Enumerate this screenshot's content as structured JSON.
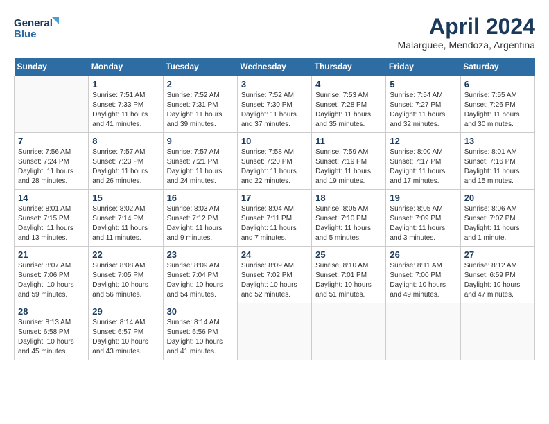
{
  "logo": {
    "line1": "General",
    "line2": "Blue"
  },
  "title": "April 2024",
  "subtitle": "Malarguee, Mendoza, Argentina",
  "days_of_week": [
    "Sunday",
    "Monday",
    "Tuesday",
    "Wednesday",
    "Thursday",
    "Friday",
    "Saturday"
  ],
  "weeks": [
    [
      {
        "day": "",
        "sunrise": "",
        "sunset": "",
        "daylight": ""
      },
      {
        "day": "1",
        "sunrise": "Sunrise: 7:51 AM",
        "sunset": "Sunset: 7:33 PM",
        "daylight": "Daylight: 11 hours and 41 minutes."
      },
      {
        "day": "2",
        "sunrise": "Sunrise: 7:52 AM",
        "sunset": "Sunset: 7:31 PM",
        "daylight": "Daylight: 11 hours and 39 minutes."
      },
      {
        "day": "3",
        "sunrise": "Sunrise: 7:52 AM",
        "sunset": "Sunset: 7:30 PM",
        "daylight": "Daylight: 11 hours and 37 minutes."
      },
      {
        "day": "4",
        "sunrise": "Sunrise: 7:53 AM",
        "sunset": "Sunset: 7:28 PM",
        "daylight": "Daylight: 11 hours and 35 minutes."
      },
      {
        "day": "5",
        "sunrise": "Sunrise: 7:54 AM",
        "sunset": "Sunset: 7:27 PM",
        "daylight": "Daylight: 11 hours and 32 minutes."
      },
      {
        "day": "6",
        "sunrise": "Sunrise: 7:55 AM",
        "sunset": "Sunset: 7:26 PM",
        "daylight": "Daylight: 11 hours and 30 minutes."
      }
    ],
    [
      {
        "day": "7",
        "sunrise": "Sunrise: 7:56 AM",
        "sunset": "Sunset: 7:24 PM",
        "daylight": "Daylight: 11 hours and 28 minutes."
      },
      {
        "day": "8",
        "sunrise": "Sunrise: 7:57 AM",
        "sunset": "Sunset: 7:23 PM",
        "daylight": "Daylight: 11 hours and 26 minutes."
      },
      {
        "day": "9",
        "sunrise": "Sunrise: 7:57 AM",
        "sunset": "Sunset: 7:21 PM",
        "daylight": "Daylight: 11 hours and 24 minutes."
      },
      {
        "day": "10",
        "sunrise": "Sunrise: 7:58 AM",
        "sunset": "Sunset: 7:20 PM",
        "daylight": "Daylight: 11 hours and 22 minutes."
      },
      {
        "day": "11",
        "sunrise": "Sunrise: 7:59 AM",
        "sunset": "Sunset: 7:19 PM",
        "daylight": "Daylight: 11 hours and 19 minutes."
      },
      {
        "day": "12",
        "sunrise": "Sunrise: 8:00 AM",
        "sunset": "Sunset: 7:17 PM",
        "daylight": "Daylight: 11 hours and 17 minutes."
      },
      {
        "day": "13",
        "sunrise": "Sunrise: 8:01 AM",
        "sunset": "Sunset: 7:16 PM",
        "daylight": "Daylight: 11 hours and 15 minutes."
      }
    ],
    [
      {
        "day": "14",
        "sunrise": "Sunrise: 8:01 AM",
        "sunset": "Sunset: 7:15 PM",
        "daylight": "Daylight: 11 hours and 13 minutes."
      },
      {
        "day": "15",
        "sunrise": "Sunrise: 8:02 AM",
        "sunset": "Sunset: 7:14 PM",
        "daylight": "Daylight: 11 hours and 11 minutes."
      },
      {
        "day": "16",
        "sunrise": "Sunrise: 8:03 AM",
        "sunset": "Sunset: 7:12 PM",
        "daylight": "Daylight: 11 hours and 9 minutes."
      },
      {
        "day": "17",
        "sunrise": "Sunrise: 8:04 AM",
        "sunset": "Sunset: 7:11 PM",
        "daylight": "Daylight: 11 hours and 7 minutes."
      },
      {
        "day": "18",
        "sunrise": "Sunrise: 8:05 AM",
        "sunset": "Sunset: 7:10 PM",
        "daylight": "Daylight: 11 hours and 5 minutes."
      },
      {
        "day": "19",
        "sunrise": "Sunrise: 8:05 AM",
        "sunset": "Sunset: 7:09 PM",
        "daylight": "Daylight: 11 hours and 3 minutes."
      },
      {
        "day": "20",
        "sunrise": "Sunrise: 8:06 AM",
        "sunset": "Sunset: 7:07 PM",
        "daylight": "Daylight: 11 hours and 1 minute."
      }
    ],
    [
      {
        "day": "21",
        "sunrise": "Sunrise: 8:07 AM",
        "sunset": "Sunset: 7:06 PM",
        "daylight": "Daylight: 10 hours and 59 minutes."
      },
      {
        "day": "22",
        "sunrise": "Sunrise: 8:08 AM",
        "sunset": "Sunset: 7:05 PM",
        "daylight": "Daylight: 10 hours and 56 minutes."
      },
      {
        "day": "23",
        "sunrise": "Sunrise: 8:09 AM",
        "sunset": "Sunset: 7:04 PM",
        "daylight": "Daylight: 10 hours and 54 minutes."
      },
      {
        "day": "24",
        "sunrise": "Sunrise: 8:09 AM",
        "sunset": "Sunset: 7:02 PM",
        "daylight": "Daylight: 10 hours and 52 minutes."
      },
      {
        "day": "25",
        "sunrise": "Sunrise: 8:10 AM",
        "sunset": "Sunset: 7:01 PM",
        "daylight": "Daylight: 10 hours and 51 minutes."
      },
      {
        "day": "26",
        "sunrise": "Sunrise: 8:11 AM",
        "sunset": "Sunset: 7:00 PM",
        "daylight": "Daylight: 10 hours and 49 minutes."
      },
      {
        "day": "27",
        "sunrise": "Sunrise: 8:12 AM",
        "sunset": "Sunset: 6:59 PM",
        "daylight": "Daylight: 10 hours and 47 minutes."
      }
    ],
    [
      {
        "day": "28",
        "sunrise": "Sunrise: 8:13 AM",
        "sunset": "Sunset: 6:58 PM",
        "daylight": "Daylight: 10 hours and 45 minutes."
      },
      {
        "day": "29",
        "sunrise": "Sunrise: 8:14 AM",
        "sunset": "Sunset: 6:57 PM",
        "daylight": "Daylight: 10 hours and 43 minutes."
      },
      {
        "day": "30",
        "sunrise": "Sunrise: 8:14 AM",
        "sunset": "Sunset: 6:56 PM",
        "daylight": "Daylight: 10 hours and 41 minutes."
      },
      {
        "day": "",
        "sunrise": "",
        "sunset": "",
        "daylight": ""
      },
      {
        "day": "",
        "sunrise": "",
        "sunset": "",
        "daylight": ""
      },
      {
        "day": "",
        "sunrise": "",
        "sunset": "",
        "daylight": ""
      },
      {
        "day": "",
        "sunrise": "",
        "sunset": "",
        "daylight": ""
      }
    ]
  ]
}
